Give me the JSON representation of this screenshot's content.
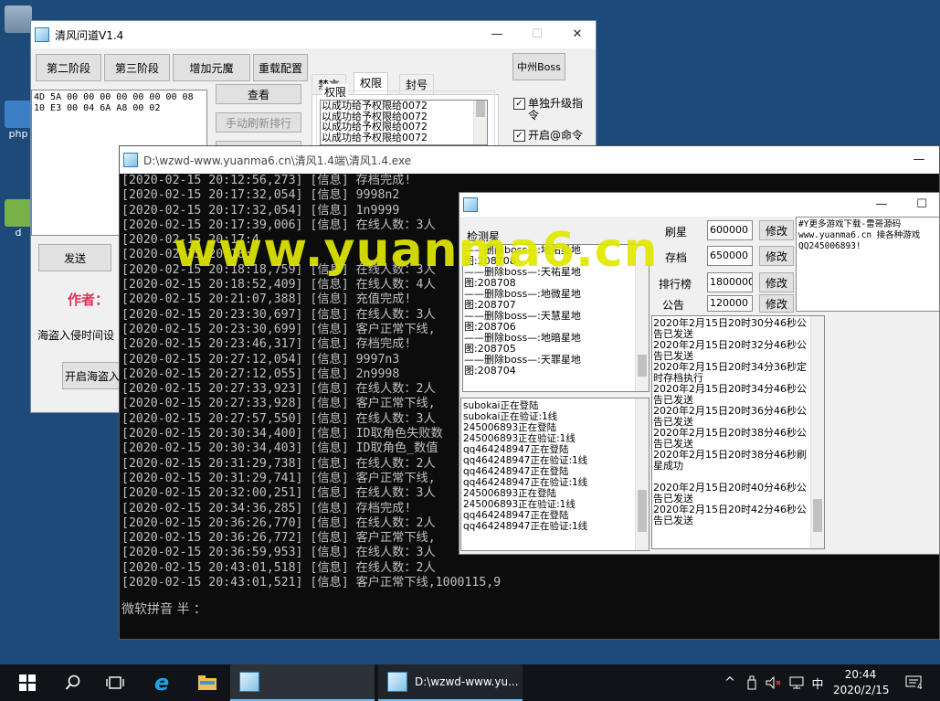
{
  "desktop": {
    "icons": [
      {
        "label": ""
      },
      {
        "label": "php"
      },
      {
        "label": "d"
      }
    ]
  },
  "win1": {
    "title": "清风问道V1.4",
    "controls": {
      "minimize": "—",
      "maximize": "☐",
      "close": "✕"
    },
    "buttons": [
      "第二阶段",
      "第三阶段",
      "增加元魔",
      "重载配置"
    ],
    "hex_text": "4D 5A 00 00 00 00 00 00 00 08\n10 E3 00 04 6A A8 00 02",
    "view_btn": "查看",
    "refresh_btn": "手动刷新排行",
    "tabs": [
      "禁言",
      "权限",
      "封号"
    ],
    "perm_group": "权限",
    "perm_lines": [
      "以成功给予权限给0072",
      "以成功给予权限给0072",
      "以成功给予权限给0072",
      "以成功给予权限给0072"
    ],
    "boss_btn": "中州Boss",
    "chk1": "单独升级指令",
    "chk2": "开启@命令",
    "send_btn": "发送",
    "author": "作者：",
    "pirate_label": "海盗入侵时间设",
    "pirate_btn": "开启海盗入"
  },
  "console": {
    "title": "D:\\wzwd-www.yuanma6.cn\\清风1.4端\\清风1.4.exe",
    "lines": [
      "[2020-02-15 20:12:56,273] [信息] 存档完成!",
      "[2020-02-15 20:17:32,054] [信息] 9998n2",
      "[2020-02-15 20:17:32,054] [信息] 1n9999",
      "[2020-02-15 20:17:39,006] [信息] 在线人数：3人",
      "[2020-02-15 20:17:4",
      "[2020-02-15 20:18:",
      "[2020-02-15 20:18:18,759] [信息] 在线人数：3人",
      "[2020-02-15 20:18:52,409] [信息] 在线人数：4人",
      "[2020-02-15 20:21:07,388] [信息] 充值完成!",
      "[2020-02-15 20:23:30,697] [信息] 在线人数：3人",
      "[2020-02-15 20:23:30,699] [信息] 客户正常下线,",
      "[2020-02-15 20:23:46,317] [信息] 存档完成!",
      "[2020-02-15 20:27:12,054] [信息] 9997n3",
      "[2020-02-15 20:27:12,055] [信息] 2n9998",
      "[2020-02-15 20:27:33,923] [信息] 在线人数：2人",
      "[2020-02-15 20:27:33,928] [信息] 客户正常下线,",
      "[2020-02-15 20:27:57,550] [信息] 在线人数：3人",
      "[2020-02-15 20:30:34,400] [信息] ID取角色失败数",
      "[2020-02-15 20:30:34,403] [信息] ID取角色_数值",
      "[2020-02-15 20:31:29,738] [信息] 在线人数：2人",
      "[2020-02-15 20:31:29,741] [信息] 客户正常下线,",
      "[2020-02-15 20:32:00,251] [信息] 在线人数：3人",
      "[2020-02-15 20:34:36,285] [信息] 存档完成!",
      "[2020-02-15 20:36:26,770] [信息] 在线人数：2人",
      "[2020-02-15 20:36:26,772] [信息] 客户正常下线,",
      "[2020-02-15 20:36:59,953] [信息] 在线人数：3人",
      "[2020-02-15 20:43:01,518] [信息] 在线人数：2人",
      "[2020-02-15 20:43:01,521] [信息] 客户正常下线,1000115,9"
    ],
    "ime": "微软拼音 半 ："
  },
  "watermark": "www.yuanma6.cn",
  "win3": {
    "label_check": "检测星",
    "boss_list": [
      "——删除boss—:地佑星地",
      "图:208708",
      "——删除boss—:天祐星地",
      "图:208708",
      "——删除boss—:地微星地",
      "图:208707",
      "——删除boss—:天慧星地",
      "图:208706",
      "——删除boss—:地暗星地",
      "图:208705",
      "——删除boss—:天罪星地",
      "图:208704"
    ],
    "params": [
      {
        "label": "刷星",
        "value": "600000",
        "btn": "修改"
      },
      {
        "label": "存档",
        "value": "650000",
        "btn": "修改"
      },
      {
        "label": "排行榜",
        "value": "1800000",
        "btn": "修改"
      },
      {
        "label": "公告",
        "value": "120000",
        "btn": "修改"
      }
    ],
    "notice_text": "#Y更多游戏下载-雷哥源码\nwww.yuanma6.cn 接各种游戏\nQQ245006893!",
    "login_list": [
      "subokai正在登陆",
      "subokai正在验证:1线",
      "245006893正在登陆",
      "245006893正在验证:1线",
      "qq464248947正在登陆",
      "qq464248947正在验证:1线",
      "qq464248947正在登陆",
      "qq464248947正在验证:1线",
      "245006893正在登陆",
      "245006893正在验证:1线",
      "qq464248947正在登陆",
      "qq464248947正在验证:1线"
    ],
    "announce_list": [
      "2020年2月15日20时30分46秒公告已发送",
      "2020年2月15日20时32分46秒公告已发送",
      "2020年2月15日20时34分36秒定时存档执行",
      "2020年2月15日20时34分46秒公告已发送",
      "2020年2月15日20时36分46秒公告已发送",
      "2020年2月15日20时38分46秒公告已发送",
      "2020年2月15日20时38分46秒刷星成功",
      "",
      "2020年2月15日20时40分46秒公告已发送",
      "2020年2月15日20时42分46秒公告已发送"
    ]
  },
  "taskbar": {
    "task2_label": "D:\\wzwd-www.yu...",
    "tray_ime": "中",
    "time": "20:44",
    "date": "2020/2/15",
    "notif_count": "4"
  },
  "colors": {
    "accent": "#2b7bb9",
    "author_red": "#e0305a",
    "watermark": "#e0e800"
  }
}
